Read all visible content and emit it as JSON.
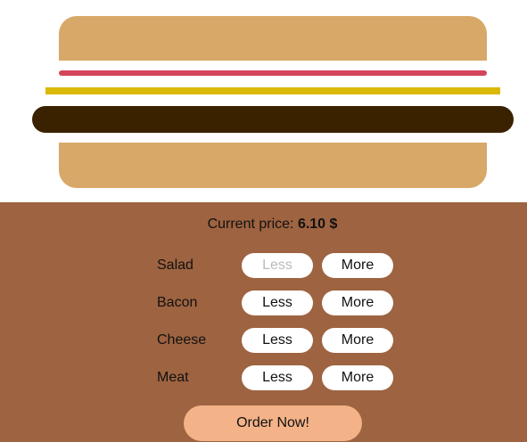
{
  "burger": {
    "layers": [
      "bun-top",
      "salad",
      "cheese",
      "meat",
      "bun-bottom"
    ],
    "colors": {
      "bun": "#D8A869",
      "salad": "#D2455A",
      "cheese": "#DBB90A",
      "meat": "#3A2200"
    }
  },
  "controls": {
    "price_prefix": "Current price: ",
    "price_value": "6.10 $",
    "background": "#9E6340",
    "ingredients": [
      {
        "label": "Salad",
        "less_label": "Less",
        "more_label": "More",
        "less_disabled": true
      },
      {
        "label": "Bacon",
        "less_label": "Less",
        "more_label": "More",
        "less_disabled": false
      },
      {
        "label": "Cheese",
        "less_label": "Less",
        "more_label": "More",
        "less_disabled": false
      },
      {
        "label": "Meat",
        "less_label": "Less",
        "more_label": "More",
        "less_disabled": false
      }
    ],
    "order_label": "Order Now!",
    "order_color": "#F3B287"
  }
}
